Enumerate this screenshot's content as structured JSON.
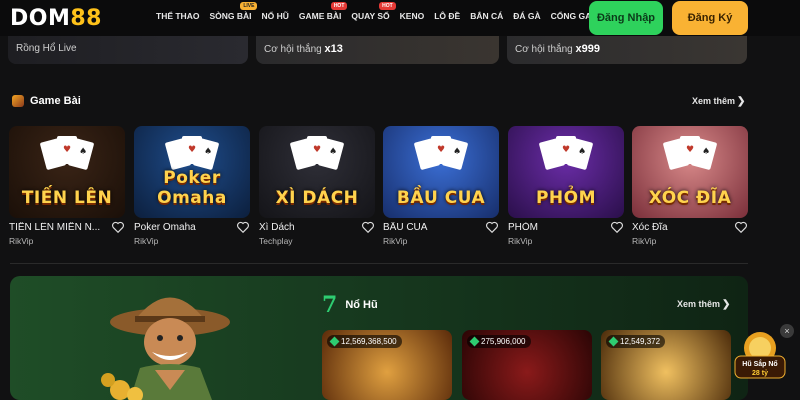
{
  "header": {
    "logo_main": "DOM",
    "logo_num": "88",
    "nav": [
      {
        "label": "THỂ THAO",
        "badge": ""
      },
      {
        "label": "SÒNG BÀI",
        "badge": "LIVE"
      },
      {
        "label": "NỔ HŨ",
        "badge": ""
      },
      {
        "label": "GAME BÀI",
        "badge": "HOT"
      },
      {
        "label": "QUAY SỐ",
        "badge": "HOT"
      },
      {
        "label": "KENO",
        "badge": ""
      },
      {
        "label": "LÔ ĐỀ",
        "badge": ""
      },
      {
        "label": "BẮN CÁ",
        "badge": ""
      },
      {
        "label": "ĐÁ GÀ",
        "badge": ""
      },
      {
        "label": "CỔNG GAME",
        "badge": ""
      }
    ],
    "login_label": "Đăng Nhập",
    "register_label": "Đăng Ký"
  },
  "strip": {
    "c1": {
      "text": "Rồng Hổ Live"
    },
    "c2": {
      "text": "Cơ hội thắng",
      "mult": "x13"
    },
    "c3": {
      "text": "Cơ hội thắng",
      "mult": "x999"
    }
  },
  "game_section": {
    "title": "Game Bài",
    "see_more": "Xem thêm",
    "games": [
      {
        "thumb_label": "TIẾN LÊN",
        "name": "TIẾN LÊN MIỀN N...",
        "provider": "RikVip",
        "color1": "#3a2416",
        "color2": "#1a0f08"
      },
      {
        "thumb_label": "Poker Omaha",
        "name": "Poker Omaha",
        "provider": "RikVip",
        "color1": "#1f4d8c",
        "color2": "#0c1f3d"
      },
      {
        "thumb_label": "XÌ DÁCH",
        "name": "Xì Dách",
        "provider": "Techplay",
        "color1": "#2f2f38",
        "color2": "#141418"
      },
      {
        "thumb_label": "BẦU CUA",
        "name": "BẦU CUA",
        "provider": "RikVip",
        "color1": "#3b6fd6",
        "color2": "#172e6b"
      },
      {
        "thumb_label": "PHỎM",
        "name": "PHỎM",
        "provider": "RikVip",
        "color1": "#6b2da8",
        "color2": "#2a0f4a"
      },
      {
        "thumb_label": "XÓC ĐĨA",
        "name": "Xóc Đĩa",
        "provider": "RikVip",
        "color1": "#d98a8a",
        "color2": "#7a2f3a"
      }
    ]
  },
  "jackpot_section": {
    "title": "Nổ Hũ",
    "seven": "7",
    "see_more": "Xem thêm",
    "cards": [
      {
        "amount": "12,569,368,500",
        "color1": "#e0a040",
        "color2": "#5a2a0a"
      },
      {
        "amount": "275,906,000",
        "color1": "#8a1a1a",
        "color2": "#2a0505"
      },
      {
        "amount": "12,549,372",
        "color1": "#f0c060",
        "color2": "#4a2a0a"
      }
    ],
    "floating": {
      "line1": "Hũ Sắp Nổ",
      "line2": "28 tỷ"
    },
    "close": "×"
  }
}
